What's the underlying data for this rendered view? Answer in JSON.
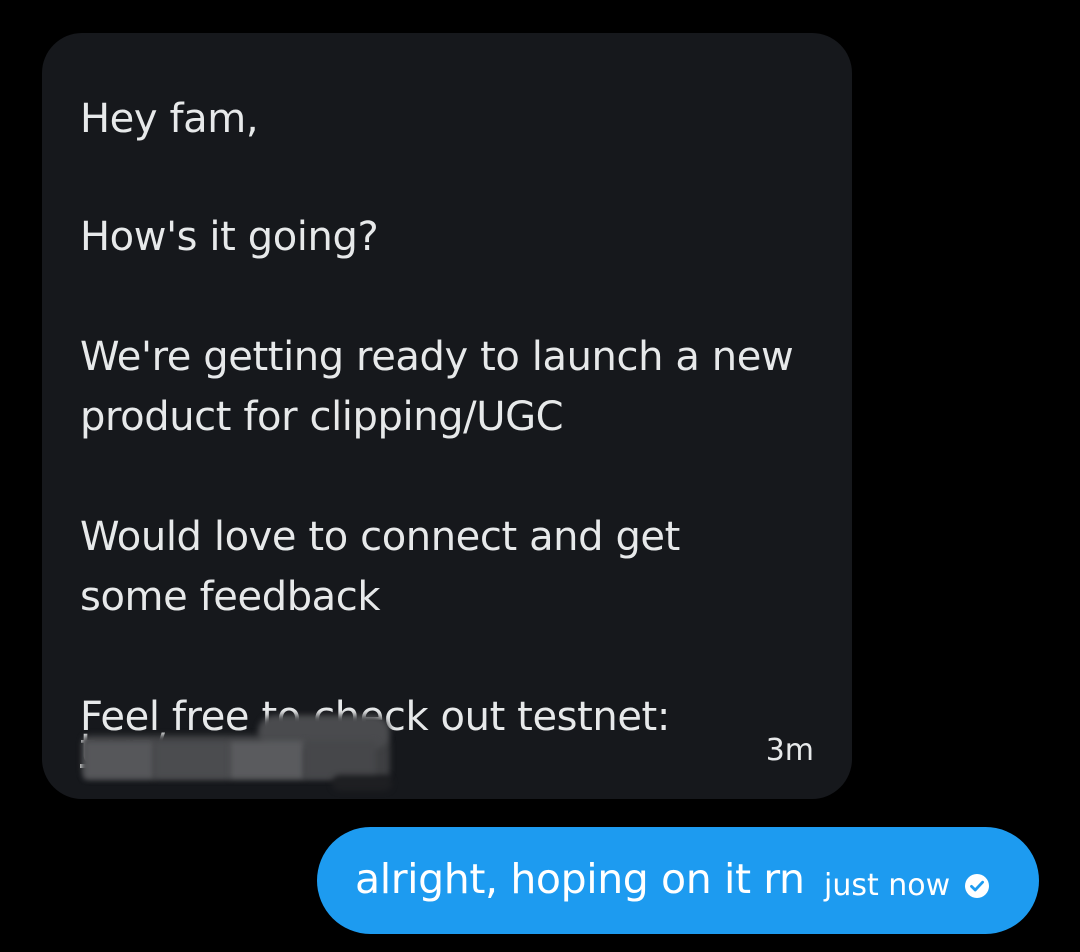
{
  "conversation": {
    "incoming": {
      "lines": [
        "Hey fam,",
        "How's it going?",
        "We're getting ready to launch a new",
        "product for clipping/UGC",
        "Would love to connect and get",
        "some feedback",
        "Feel free to check out testnet:"
      ],
      "link_text": "t            yz/",
      "timestamp": "3m"
    },
    "outgoing": {
      "text": "alright, hoping on it rn",
      "timestamp": "just now",
      "status_icon": "seen-check-icon"
    }
  },
  "colors": {
    "background": "#000000",
    "incoming_bubble": "#16181c",
    "outgoing_bubble": "#1d9bf0",
    "text_primary": "#e7e9ea",
    "text_on_accent": "#ffffff"
  }
}
